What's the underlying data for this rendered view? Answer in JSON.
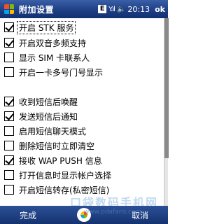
{
  "titlebar": {
    "title": "附加设置",
    "e_badge": "E",
    "signal": "Y.ıl",
    "volume_icon": "speaker-icon",
    "time": "20:13",
    "ok_label": "ok"
  },
  "options": [
    {
      "label": "开启 STK 服务",
      "checked": true
    },
    {
      "label": "开启双音多频支持",
      "checked": true
    },
    {
      "label": "显示 SIM 卡联系人",
      "checked": false
    },
    {
      "label": "开启一卡多号门号显示",
      "checked": false
    },
    {
      "label": "收到短信后唤醒",
      "checked": true
    },
    {
      "label": "发送短信后通知",
      "checked": true
    },
    {
      "label": "启用短信聊天模式",
      "checked": false
    },
    {
      "label": "删除短信时立即清空",
      "checked": false
    },
    {
      "label": "接收 WAP PUSH 信息",
      "checked": true
    },
    {
      "label": "打开信息时显示帐户选择",
      "checked": false
    },
    {
      "label": "开启短信转存(私密短信)",
      "checked": false
    }
  ],
  "softkeys": {
    "left": "完成",
    "right": "取消"
  },
  "watermark": {
    "text": "口袋数码手机网",
    "url": "www.pdafans.com"
  }
}
